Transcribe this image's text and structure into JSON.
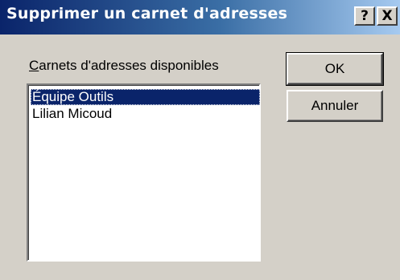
{
  "window": {
    "title": "Supprimer un carnet d'adresses",
    "help_label": "?",
    "close_label": "X"
  },
  "list": {
    "label_first": "C",
    "label_rest": "arnets d'adresses disponibles",
    "items": [
      {
        "label": "Équipe Outils",
        "selected": true
      },
      {
        "label": "Lilian Micoud",
        "selected": false
      }
    ]
  },
  "buttons": {
    "ok_label": "OK",
    "cancel_label": "Annuler"
  },
  "colors": {
    "title_start": "#0a246a",
    "selection": "#0a246a",
    "face": "#d4d0c8"
  }
}
